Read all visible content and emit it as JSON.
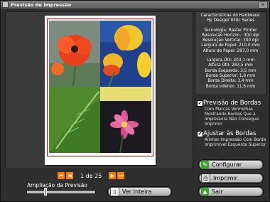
{
  "window": {
    "title": "Previsão de Impressão",
    "close_glyph": "✕"
  },
  "printer_info": {
    "heading": "Caracteristicas do Hardware:",
    "model": "Hp DeskJet 930c Series",
    "technology": "Tecnologia: Raster Printer",
    "res_h": "Resolução Horizon.: 300 dpi",
    "res_v": "Resolução Vertical: 300 dpi",
    "paper_w": "Largura do Papel: 210,0 mm",
    "paper_h": "Altura do Papel: 297,0 mm",
    "usable_w": "Largura Útil: 203,1 mm",
    "usable_h": "Altura Útil: 283,5 mm",
    "margin_l": "Borda Esquerda: 3,5 mm",
    "margin_t": "Borda Superior: 1,8 mm",
    "margin_r": "Borda Direita: 3,4 mm",
    "margin_b": "Borda Inferior: 11,6 mm"
  },
  "options": {
    "preview_borders": {
      "title": "Previsão de Bordas",
      "checked": true,
      "check_glyph": "✔",
      "description": "Com Marcas Vermelhas Mostrando Bordas Que a Impressora Não Consegue Imprimir"
    },
    "adjust_borders": {
      "title": "Ajustar às Bordas",
      "checked": true,
      "check_glyph": "✔",
      "description": "Alinhar Impressão Com Borda Imprimivel Esquerda Superior"
    }
  },
  "pagination": {
    "page_text": "1 de 25",
    "first_glyph": "⏮",
    "prev_glyph": "◀",
    "next_glyph": "▶",
    "last_glyph": "⏭"
  },
  "zoom": {
    "label": "Ampliação da Previsão",
    "level": 0.27
  },
  "buttons": {
    "configure": "Configurar",
    "print": "Imprimir",
    "exit": "Sair",
    "view_full": "Ver Inteira"
  },
  "icons": {
    "configure": "wrench-icon",
    "print": "printer-icon",
    "exit": "up-arrow-icon",
    "view_full": "page-icon"
  },
  "colors": {
    "accent_orange": "#ff7a00",
    "border_red": "#e00000",
    "panel_bg": "#3c3c3c",
    "window_bg": "#2e2e2e"
  }
}
